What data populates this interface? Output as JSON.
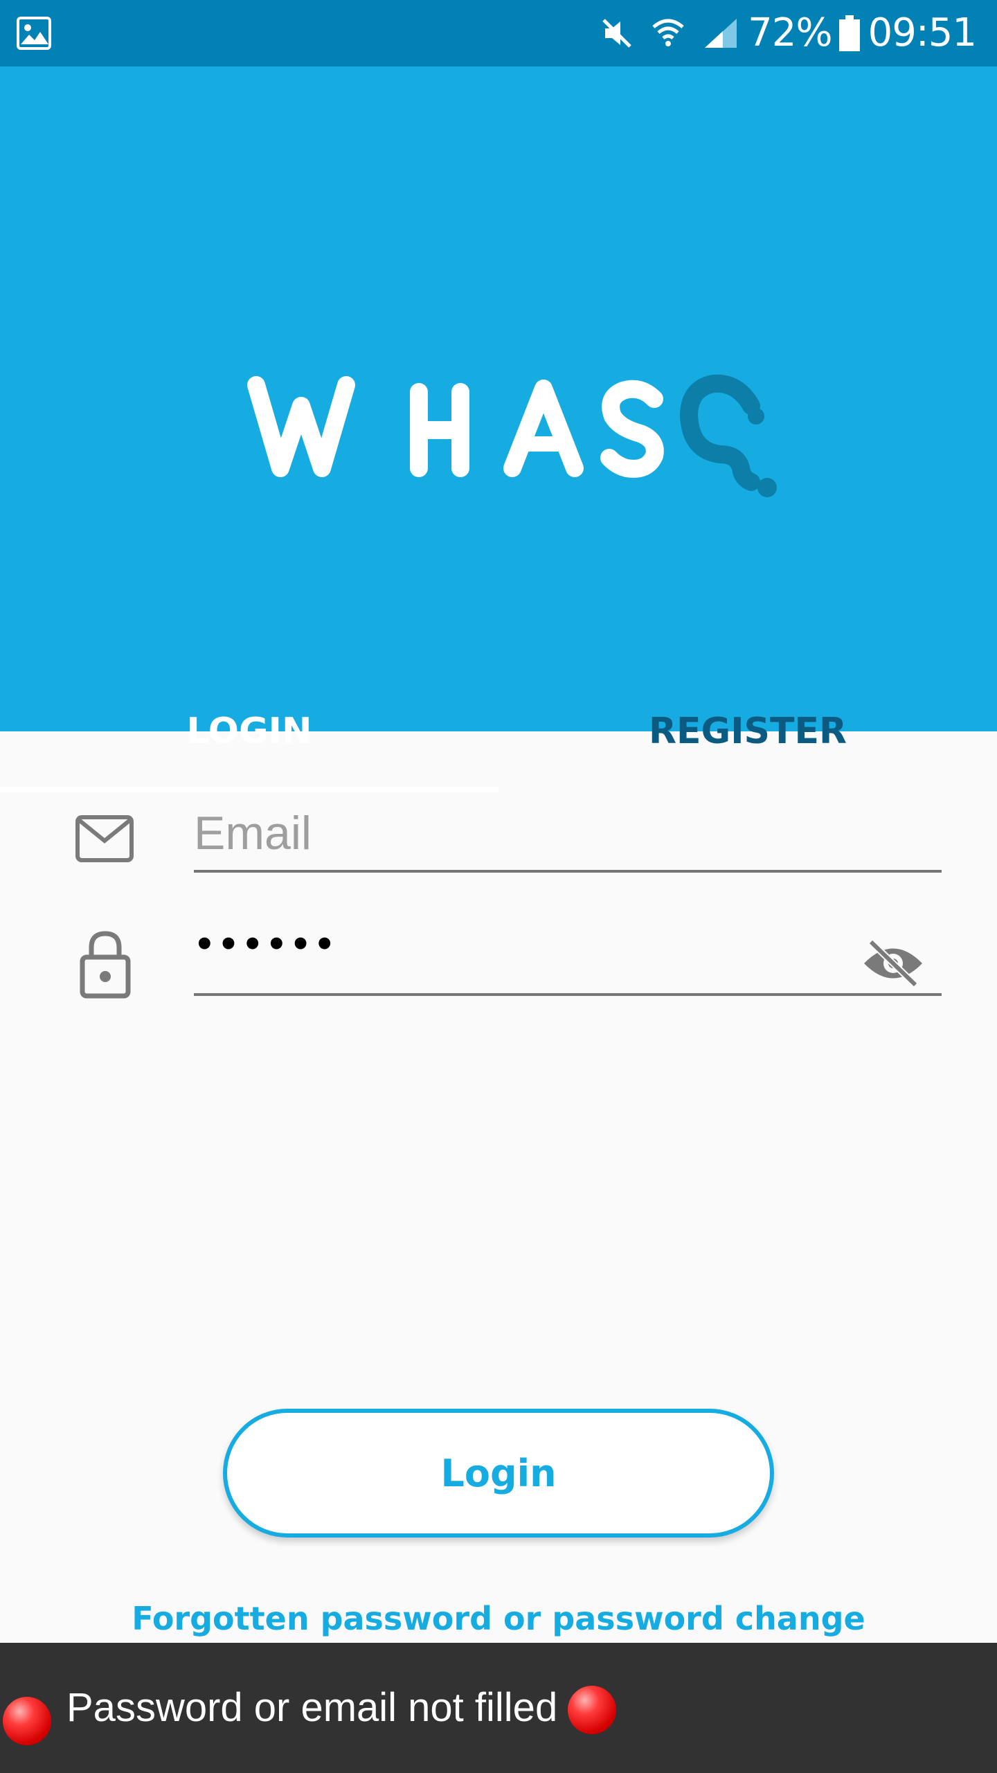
{
  "status_bar": {
    "battery": "72%",
    "time": "09:51",
    "icons": [
      "image-icon",
      "mute-icon",
      "wifi-icon",
      "signal-icon",
      "battery-icon"
    ]
  },
  "header": {
    "logo_text": "WHASQ",
    "logo_accent_color": "#0c7ea8",
    "background_color": "#16ace2"
  },
  "tabs": [
    {
      "label": "LOGIN",
      "active": true
    },
    {
      "label": "REGISTER",
      "active": false
    }
  ],
  "form": {
    "email": {
      "placeholder": "Email",
      "value": ""
    },
    "password": {
      "value": "••••••",
      "masked": true
    }
  },
  "actions": {
    "login_label": "Login",
    "forgot_label": "Forgotten password or password change"
  },
  "toast": {
    "message": "Password or email not filled"
  },
  "colors": {
    "primary": "#16ace2",
    "status_bar": "#0281b4",
    "toast_bg": "#323232"
  }
}
